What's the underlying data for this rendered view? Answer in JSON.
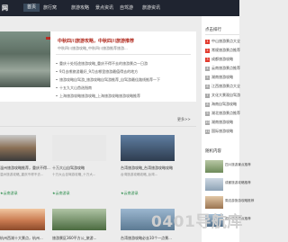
{
  "nav": {
    "brand": "网",
    "items": [
      {
        "label": "首页",
        "active": true
      },
      {
        "label": "旅行窝"
      },
      {
        "label": "旅游攻略"
      },
      {
        "label": "景点资讯"
      },
      {
        "label": "自驾游"
      },
      {
        "label": "旅游资讯"
      }
    ]
  },
  "headline": {
    "title": "中秋四川旅游攻略，中秋四川旅游推荐",
    "subtitle": "中秋四川旅游攻略_中秋四川旅游推荐旅游..."
  },
  "list": [
    "重庆十处短途旅游攻略_重庆不得不去的旅游景点一日游",
    "9月去哪旅游最好_9月去哪里旅游最值得去的地方",
    "旅游攻略自驾游_旅游攻略自驾游推荐_自驾游最佳路线推荐一下",
    "十五九大山首选指南",
    "上海旅游攻略旅游攻略_上海旅游攻略旅游攻略推荐"
  ],
  "more": "更多>>",
  "cards": [
    {
      "title": "温州旅游攻略推荐，重庆不得...",
      "sub": "温州旅游攻略_重庆不得不去..."
    },
    {
      "title": "十万大山自驾游攻略",
      "sub": "十万大山自驾游攻略_十万大..."
    },
    {
      "title": "台湾旅游攻略_台湾旅游攻略攻略",
      "sub": "台湾旅游攻略攻略_台湾..."
    }
  ],
  "card_tags": [
    "★云南游录",
    "★云南游录",
    "★云南游录"
  ],
  "cards2": [
    {
      "title": "杭州西湖十大景点，杭州..."
    },
    {
      "title": "旅游景区360平方公_旅游..."
    },
    {
      "title": "台湾旅游攻略必去10个一点景..."
    }
  ],
  "sidebar": {
    "title": "点击排行",
    "items": [
      {
        "n": "1",
        "label": "中山旅游景点大全"
      },
      {
        "n": "2",
        "label": "常规旅游景点推荐"
      },
      {
        "n": "3",
        "label": "成都旅游攻略"
      },
      {
        "n": "4",
        "label": "云南旅游景点推荐"
      },
      {
        "n": "5",
        "label": "湖南旅游攻略"
      },
      {
        "n": "6",
        "label": "江西旅游景点大全"
      },
      {
        "n": "7",
        "label": "文化大景观自驾游"
      },
      {
        "n": "8",
        "label": "海南自驾游攻略"
      },
      {
        "n": "9",
        "label": "湖北旅游景点推荐"
      },
      {
        "n": "10",
        "label": "湖南旅游攻略"
      },
      {
        "n": "11",
        "label": "国际旅游攻略"
      }
    ],
    "title2": "随机内容",
    "random": [
      {
        "label": "四川旅游景点推荐"
      },
      {
        "label": "成都旅游攻略推荐"
      },
      {
        "label": "周边游旅游攻略推荐"
      },
      {
        "label": "国外旅游景点推荐"
      }
    ]
  },
  "watermark": "0401导航库"
}
